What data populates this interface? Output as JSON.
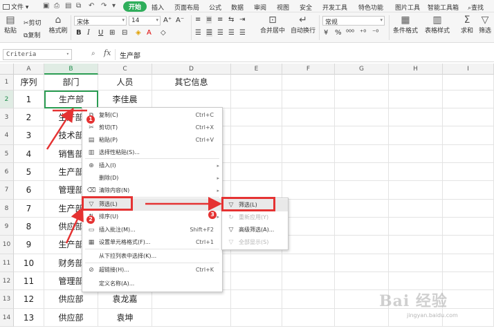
{
  "menubar": {
    "file": "文件",
    "tabs": [
      "开始",
      "插入",
      "页面布局",
      "公式",
      "数据",
      "审阅",
      "视图",
      "安全",
      "开发工具",
      "特色功能",
      "图片工具",
      "智能工具箱"
    ],
    "active_tab": "开始",
    "search": "查找"
  },
  "ribbon": {
    "paste": "粘贴",
    "cut": "剪切",
    "copy": "复制",
    "format_painter": "格式刷",
    "font_name": "宋体",
    "font_size": "14",
    "merge_center": "合并居中",
    "auto_wrap": "自动换行",
    "number_format": "常规",
    "conditional_format": "条件格式",
    "table_style": "表格样式",
    "sum": "求和",
    "filter": "筛选"
  },
  "formula_bar": {
    "name_box": "Criteria",
    "fx": "fx",
    "content": "生产部"
  },
  "sheet": {
    "columns": [
      "A",
      "B",
      "C",
      "D",
      "E",
      "F",
      "G",
      "H",
      "I"
    ],
    "rows": [
      [
        "序列",
        "部门",
        "人员",
        "其它信息"
      ],
      [
        "1",
        "生产部",
        "李佳晨",
        ""
      ],
      [
        "2",
        "生产部",
        "",
        ""
      ],
      [
        "3",
        "技术部",
        "",
        ""
      ],
      [
        "4",
        "销售部",
        "",
        ""
      ],
      [
        "5",
        "生产部",
        "",
        ""
      ],
      [
        "6",
        "管理部",
        "",
        ""
      ],
      [
        "7",
        "生产部",
        "",
        ""
      ],
      [
        "8",
        "供应部",
        "",
        ""
      ],
      [
        "9",
        "生产部",
        "",
        ""
      ],
      [
        "10",
        "财务部",
        "",
        ""
      ],
      [
        "11",
        "管理部",
        "",
        ""
      ],
      [
        "12",
        "供应部",
        "袁龙嘉",
        ""
      ],
      [
        "13",
        "供应部",
        "袁坤",
        ""
      ]
    ]
  },
  "context_menu": {
    "items": [
      {
        "label": "复制(C)",
        "shortcut": "Ctrl+C",
        "icon": "copy-icon"
      },
      {
        "label": "剪切(T)",
        "shortcut": "Ctrl+X",
        "icon": "cut-icon"
      },
      {
        "label": "粘贴(P)",
        "shortcut": "Ctrl+V",
        "icon": "paste-icon"
      },
      {
        "label": "选择性粘贴(S)...",
        "shortcut": "",
        "icon": "paste-special-icon"
      },
      {
        "label": "插入(I)",
        "shortcut": "",
        "icon": "insert-icon",
        "submenu": true
      },
      {
        "label": "删除(D)",
        "shortcut": "",
        "icon": "",
        "submenu": true
      },
      {
        "label": "清除内容(N)",
        "shortcut": "",
        "icon": "eraser-icon",
        "submenu": true
      },
      {
        "label": "筛选(L)",
        "shortcut": "",
        "icon": "filter-icon",
        "submenu": true
      },
      {
        "label": "排序(U)",
        "shortcut": "",
        "icon": "sort-icon",
        "submenu": true
      },
      {
        "label": "插入批注(M)...",
        "shortcut": "Shift+F2",
        "icon": "comment-icon"
      },
      {
        "label": "设置单元格格式(F)...",
        "shortcut": "Ctrl+1",
        "icon": "format-cells-icon"
      },
      {
        "label": "从下拉列表中选择(K)...",
        "shortcut": "",
        "icon": ""
      },
      {
        "label": "超链接(H)...",
        "shortcut": "Ctrl+K",
        "icon": "link-icon"
      },
      {
        "label": "定义名称(A)...",
        "shortcut": "",
        "icon": ""
      }
    ]
  },
  "submenu": {
    "items": [
      {
        "label": "筛选(L)",
        "enabled": true
      },
      {
        "label": "重新应用(Y)",
        "enabled": false
      },
      {
        "label": "高级筛选(A)...",
        "enabled": true
      },
      {
        "label": "全部显示(S)",
        "enabled": false
      }
    ]
  },
  "annotations": {
    "badges": [
      "1",
      "2",
      "3"
    ],
    "color": "#e53232"
  },
  "watermark": {
    "logo": "Bai 经验",
    "url": "jingyan.baidu.com"
  },
  "colors": {
    "accent": "#2fae5b",
    "selection": "#2a9c52",
    "highlight": "#e53232"
  }
}
